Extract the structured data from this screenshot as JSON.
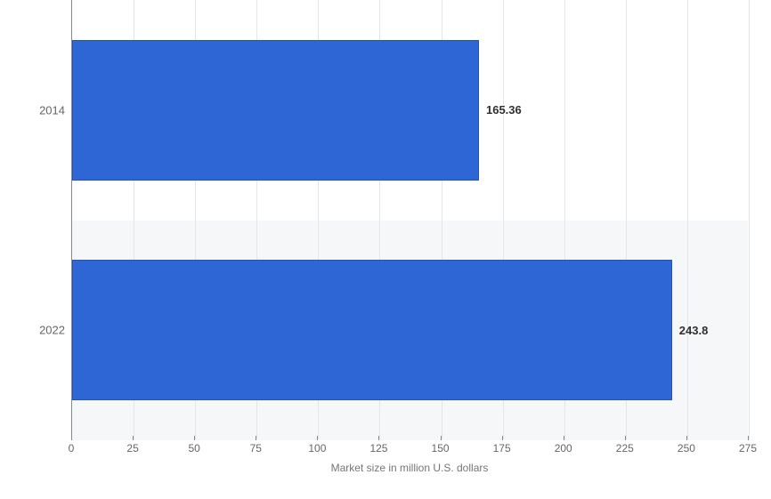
{
  "chart_data": {
    "type": "bar",
    "orientation": "horizontal",
    "categories": [
      "2014",
      "2022"
    ],
    "values": [
      165.36,
      243.8
    ],
    "xlabel": "Market size in million U.S. dollars",
    "ylabel": "",
    "xlim": [
      0,
      275
    ],
    "xticks": [
      0,
      25,
      50,
      75,
      100,
      125,
      150,
      175,
      200,
      225,
      250,
      275
    ],
    "bar_color": "#2e66d6",
    "grid": true
  }
}
